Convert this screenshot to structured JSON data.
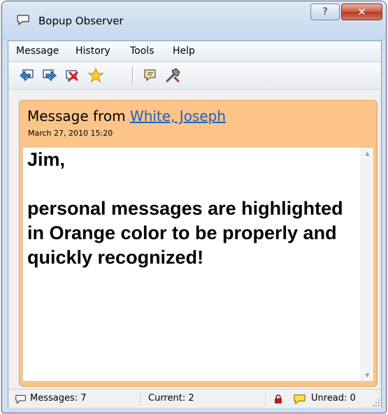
{
  "window": {
    "title": "Bopup Observer",
    "help_label": "?",
    "close_label": "✕"
  },
  "menu": {
    "items": [
      "Message",
      "History",
      "Tools",
      "Help"
    ]
  },
  "toolbar": {
    "buttons": [
      "previous-message-icon",
      "next-message-icon",
      "delete-message-icon",
      "favorite-star-icon",
      "send-message-icon",
      "settings-icon"
    ]
  },
  "message": {
    "from_prefix": "Message from ",
    "sender": "White, Joseph",
    "date": "March 27, 2010 15:20",
    "body": "Jim,\n\npersonal messages are highlighted in Orange color to be properly and quickly recognized!"
  },
  "status": {
    "messages": "Messages: 7",
    "current": "Current: 2",
    "unread": "Unread: 0"
  },
  "colors": {
    "panel": "#fcc488",
    "link": "#1f5fbf",
    "close_button": "#c75b45"
  }
}
